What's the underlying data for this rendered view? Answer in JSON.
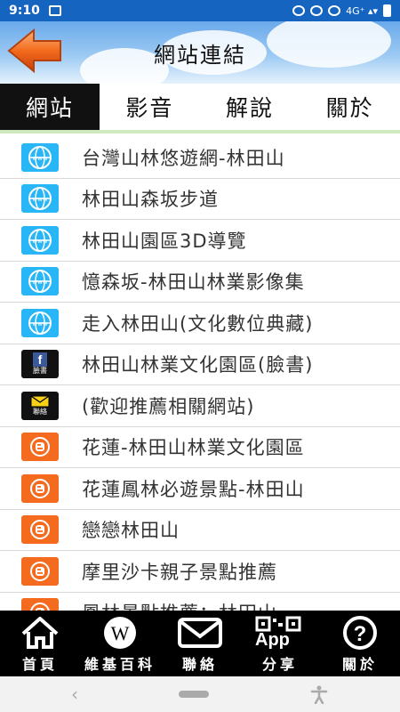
{
  "status_bar": {
    "time": "9:10",
    "network": "4G⁺ ▴▾"
  },
  "header": {
    "title": "網站連結"
  },
  "tabs": [
    {
      "label": "網站",
      "active": true
    },
    {
      "label": "影音",
      "active": false
    },
    {
      "label": "解說",
      "active": false
    },
    {
      "label": "關於",
      "active": false
    }
  ],
  "links": [
    {
      "label": "台灣山林悠遊網-林田山",
      "icon": "globe-icon"
    },
    {
      "label": "林田山森坂步道",
      "icon": "globe-icon"
    },
    {
      "label": "林田山園區3D導覽",
      "icon": "globe-icon"
    },
    {
      "label": "憶森坂-林田山林業影像集",
      "icon": "globe-icon"
    },
    {
      "label": "走入林田山(文化數位典藏)",
      "icon": "globe-icon"
    },
    {
      "label": "林田山林業文化園區(臉書)",
      "icon": "facebook-icon",
      "icon_text": "臉書"
    },
    {
      "label": "(歡迎推薦相關網站)",
      "icon": "mail-icon",
      "icon_text": "聯絡"
    },
    {
      "label": "花蓮-林田山林業文化園區",
      "icon": "blogger-icon"
    },
    {
      "label": "花蓮鳳林必遊景點-林田山",
      "icon": "blogger-icon"
    },
    {
      "label": "戀戀林田山",
      "icon": "blogger-icon"
    },
    {
      "label": "摩里沙卡親子景點推薦",
      "icon": "blogger-icon"
    },
    {
      "label": "鳳林景點推薦：林田山",
      "icon": "blogger-icon"
    }
  ],
  "bottom_nav": [
    {
      "label": "首頁",
      "icon": "home-icon"
    },
    {
      "label": "維基百科",
      "icon": "wikipedia-icon"
    },
    {
      "label": "聯絡",
      "icon": "mail-icon"
    },
    {
      "label": "分享",
      "icon": "qr-app-icon",
      "icon_text": "App"
    },
    {
      "label": "關於",
      "icon": "help-icon"
    }
  ],
  "colors": {
    "status_bar": "#1565c0",
    "www_icon": "#29b6f6",
    "blogger_icon": "#f46a1f",
    "back_arrow": "#f26b1d",
    "tab_active_bg": "#111111",
    "bottom_bar": "#000000"
  }
}
